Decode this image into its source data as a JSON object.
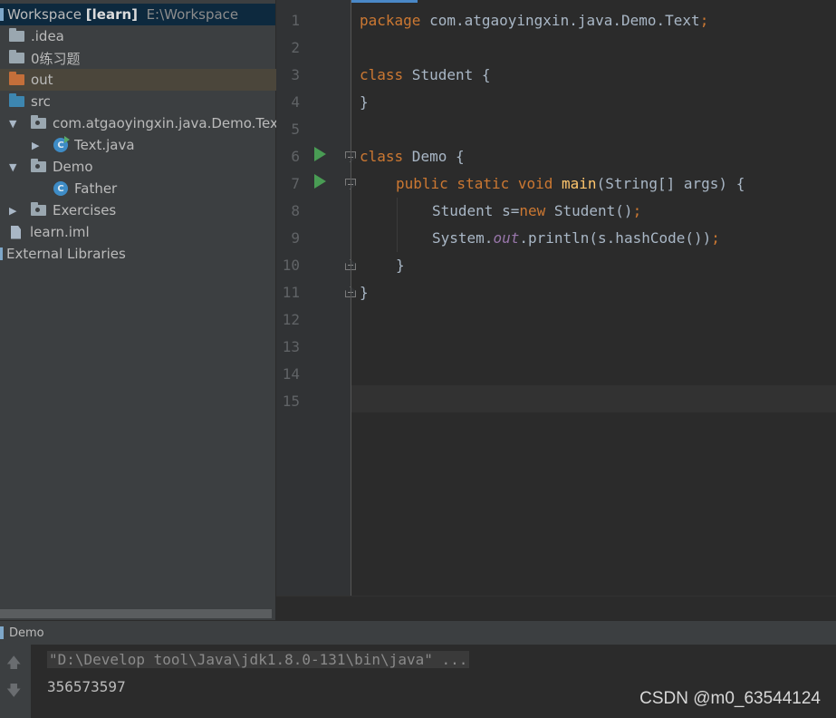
{
  "project_tree": {
    "root": {
      "name": "Workspace",
      "module": "[learn]",
      "path": "E:\\Workspace"
    },
    "items": [
      {
        "label": ".idea"
      },
      {
        "label": "0练习题"
      },
      {
        "label": "out"
      },
      {
        "label": "src"
      },
      {
        "label": "com.atgaoyingxin.java.Demo.Text"
      },
      {
        "label": "Text.java"
      },
      {
        "label": "Demo"
      },
      {
        "label": "Father"
      },
      {
        "label": "Exercises"
      },
      {
        "label": "learn.iml"
      },
      {
        "label": "External Libraries"
      }
    ],
    "class_icon_letter": "C"
  },
  "editor": {
    "line_numbers": [
      "1",
      "2",
      "3",
      "4",
      "5",
      "6",
      "7",
      "8",
      "9",
      "10",
      "11",
      "12",
      "13",
      "14",
      "15"
    ],
    "code": {
      "l1": {
        "kw": "package",
        "rest": " com.atgaoyingxin.java.Demo.Text",
        "semi": ";"
      },
      "l3": {
        "kw": "class",
        "rest": " Student {"
      },
      "l4": {
        "text": "}"
      },
      "l6": {
        "kw": "class",
        "rest": " Demo {"
      },
      "l7": {
        "mods": "public static void",
        "fn": "main",
        "rest": "(String[] args) {"
      },
      "l8": {
        "a": "Student s=",
        "kw": "new",
        "b": " Student()",
        "semi": ";"
      },
      "l9": {
        "a": "System.",
        "fld": "out",
        "b": ".println(s.hashCode())",
        "semi": ";"
      },
      "l10": {
        "text": "}"
      },
      "l11": {
        "text": "}"
      }
    }
  },
  "run_panel": {
    "title": "Demo",
    "command": "\"D:\\Develop tool\\Java\\jdk1.8.0-131\\bin\\java\" ...",
    "output": "356573597",
    "up_icon": "arrow-up-icon",
    "down_icon": "arrow-down-icon"
  },
  "watermark": "CSDN @m0_63544124",
  "colors": {
    "keyword": "#cc7832",
    "method": "#ffc66d",
    "field": "#9876aa",
    "text": "#a9b7c6",
    "run": "#499c54",
    "selection": "#0d293e"
  }
}
